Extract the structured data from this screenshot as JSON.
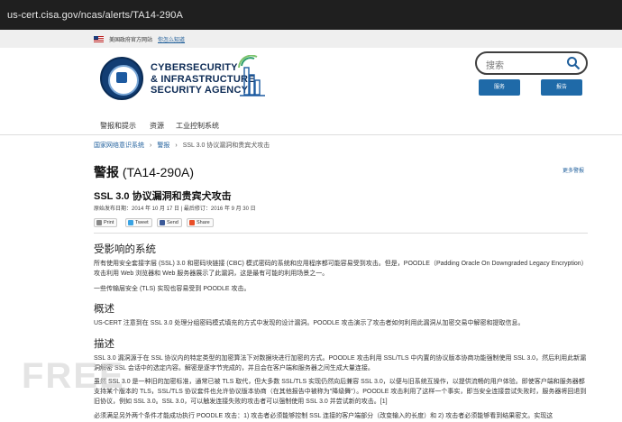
{
  "browser": {
    "url": "us-cert.cisa.gov/ncas/alerts/TA14-290A"
  },
  "gov_banner": {
    "text": "美国政府官方网站",
    "link": "你怎么知道"
  },
  "header": {
    "agency_lines": [
      "CYBERSECURITY",
      "& INFRASTRUCTURE",
      "SECURITY AGENCY"
    ],
    "search_placeholder": "搜索",
    "services_button": "服务",
    "report_button": "报告"
  },
  "nav": {
    "items": [
      "警报和提示",
      "资源",
      "工业控制系统"
    ]
  },
  "breadcrumb": {
    "items": [
      "国家网络意识系统",
      "警报",
      "SSL 3.0 协议漏洞和贵宾犬攻击"
    ]
  },
  "alert": {
    "label": "警报",
    "id": "(TA14-290A)",
    "more_link": "更多警报",
    "title": "SSL 3.0 协议漏洞和贵宾犬攻击",
    "dates": "原始发布日期：2014 年 10 月 17 日 | 最后修订：2016 年 9 月 30 日"
  },
  "share": {
    "print": "Print",
    "tweet": "Tweet",
    "send": "Send",
    "share": "Share"
  },
  "sections": {
    "affected": {
      "heading": "受影响的系统",
      "p1": "所有使用安全套接字层 (SSL) 3.0 和密码块链接 (CBC) 模式密码的系统和应用程序都可能容易受到攻击。但是，POODLE（Padding Oracle On Downgraded Legacy Encryption）攻击利用 Web 浏览器和 Web 服务器展示了此漏洞，这是最有可能的利用场景之一。",
      "p2": "一些传输层安全 (TLS) 实现也容易受到 POODLE 攻击。"
    },
    "overview": {
      "heading": "概述",
      "p1": "US-CERT 注意到在 SSL 3.0 处理分组密码模式填充的方式中发现的设计漏洞。POODLE 攻击演示了攻击者如何利用此漏洞从加密交易中解密和提取信息。"
    },
    "description": {
      "heading": "描述",
      "p1": "SSL 3.0 漏洞源于在 SSL 协议内的特定类型的加密算法下对数据块进行加密的方式。POODLE 攻击利用 SSL/TLS 中内置的协议版本协商功能强制使用 SSL 3.0，然后利用此新漏洞解密 SSL 会话中的选定内容。解密是逐字节完成的，并且会在客户端和服务器之间生成大量连接。",
      "p2": "虽然 SSL 3.0 是一种旧的加密标准，通常已被 TLS 取代，但大多数 SSL/TLS 实现仍然向后兼容 SSL 3.0，以便与旧系统互操作，以提供流畅的用户体验。即使客户端和服务器都支持某个版本的 TLS，SSL/TLS 协议套件也允许协议版本协商（在其他报告中被称为\"降级舞\"）。POODLE 攻击利用了这样一个事实，即当安全连接尝试失败时，服务器将回退到旧协议，例如 SSL 3.0。SSL 3.0，可以触发连接失败的攻击者可以强制使用 SSL 3.0 并尝试新的攻击。[1]",
      "p3": "必须满足另外两个条件才能成功执行 POODLE 攻击：1) 攻击者必须能够控制 SSL 连接的客户端部分（改变输入的长度）和 2) 攻击者必须能够看到结果密文。实现这"
    }
  }
}
